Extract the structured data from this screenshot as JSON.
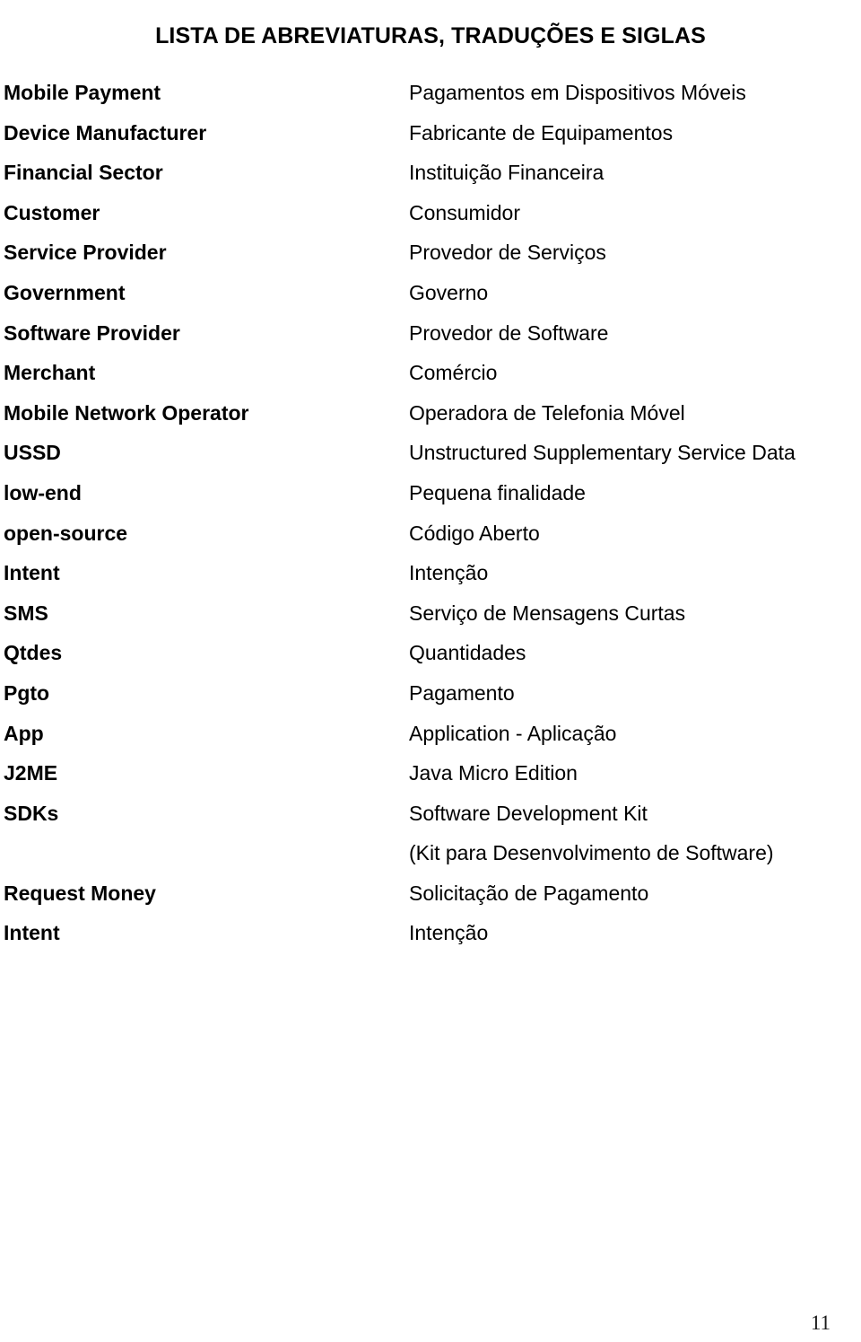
{
  "document": {
    "title": "LISTA DE ABREVIATURAS, TRADUÇÕES E SIGLAS",
    "page_number": "11"
  },
  "glossary": {
    "entries": [
      {
        "term": "Mobile Payment",
        "definition": "Pagamentos em Dispositivos Móveis",
        "continuation": false
      },
      {
        "term": "Device Manufacturer",
        "definition": "Fabricante de Equipamentos",
        "continuation": false
      },
      {
        "term": "Financial Sector",
        "definition": "Instituição Financeira",
        "continuation": false
      },
      {
        "term": "Customer",
        "definition": "Consumidor",
        "continuation": false
      },
      {
        "term": "Service Provider",
        "definition": "Provedor de Serviços",
        "continuation": false
      },
      {
        "term": "Government",
        "definition": "Governo",
        "continuation": false
      },
      {
        "term": "Software Provider",
        "definition": "Provedor de Software",
        "continuation": false
      },
      {
        "term": "Merchant",
        "definition": "Comércio",
        "continuation": false
      },
      {
        "term": "Mobile Network Operator",
        "definition": "Operadora de Telefonia Móvel",
        "continuation": false
      },
      {
        "term": "USSD",
        "definition": "Unstructured Supplementary Service Data",
        "continuation": false
      },
      {
        "term": "low-end",
        "definition": "Pequena finalidade",
        "continuation": false
      },
      {
        "term": "open-source",
        "definition": "Código Aberto",
        "continuation": false
      },
      {
        "term": "Intent",
        "definition": "Intenção",
        "continuation": false
      },
      {
        "term": "SMS",
        "definition": "Serviço de Mensagens Curtas",
        "continuation": false
      },
      {
        "term": "Qtdes",
        "definition": "Quantidades",
        "continuation": false
      },
      {
        "term": "Pgto",
        "definition": "Pagamento",
        "continuation": false
      },
      {
        "term": "App",
        "definition": "Application - Aplicação",
        "continuation": false
      },
      {
        "term": "J2ME",
        "definition": "Java Micro Edition",
        "continuation": false
      },
      {
        "term": "SDKs",
        "definition": "Software Development Kit",
        "continuation": false
      },
      {
        "term": "",
        "definition": "(Kit para Desenvolvimento de Software)",
        "continuation": true
      },
      {
        "term": "Request Money",
        "definition": "Solicitação de Pagamento",
        "continuation": false
      },
      {
        "term": "Intent",
        "definition": "Intenção",
        "continuation": false
      }
    ]
  }
}
